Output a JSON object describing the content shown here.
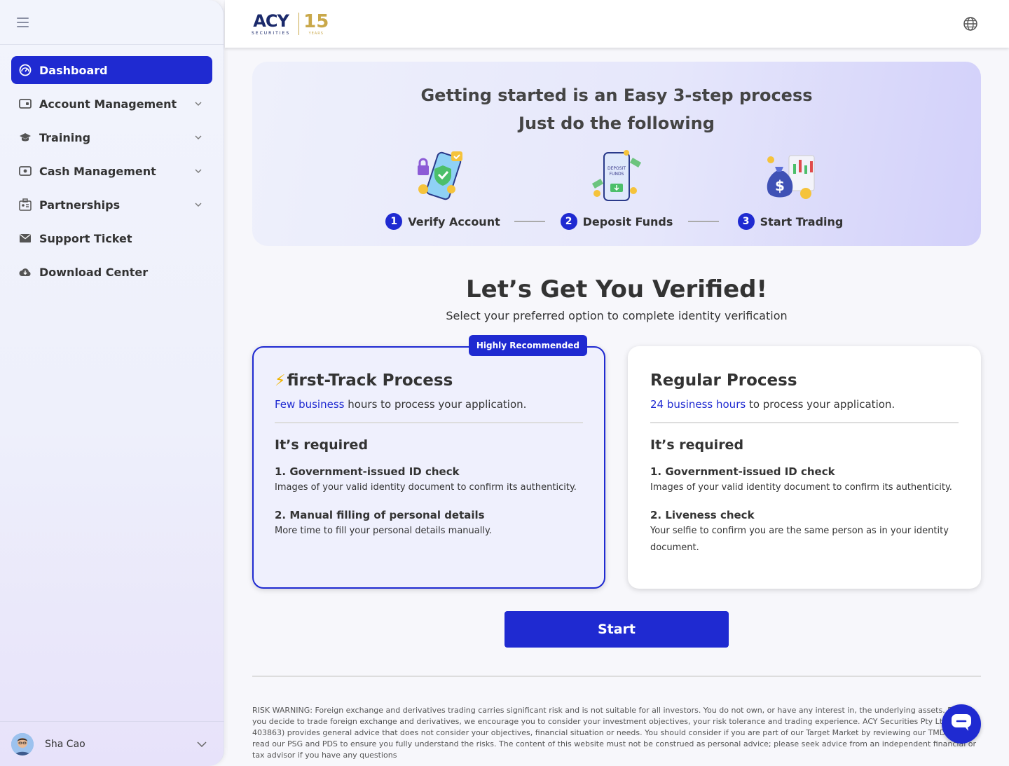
{
  "sidebar": {
    "items": [
      {
        "label": "Dashboard",
        "icon": "dashboard-icon",
        "active": true
      },
      {
        "label": "Account Management",
        "icon": "wallet-icon",
        "expandable": true
      },
      {
        "label": "Training",
        "icon": "graduation-cap-icon",
        "expandable": true
      },
      {
        "label": "Cash Management",
        "icon": "cash-icon",
        "expandable": true
      },
      {
        "label": "Partnerships",
        "icon": "partnerships-icon",
        "expandable": true
      },
      {
        "label": "Support Ticket",
        "icon": "envelope-icon"
      },
      {
        "label": "Download Center",
        "icon": "cloud-download-icon"
      }
    ],
    "user": {
      "name": "Sha Cao"
    }
  },
  "header": {
    "logo": {
      "brand": "ACY",
      "sub": "SECURITIES",
      "anniversary": "15",
      "anniversary_sub": "YEARS"
    }
  },
  "steps": {
    "title_line1": "Getting started is an Easy 3-step process",
    "title_line2": "Just do the following",
    "items": [
      {
        "num": "1",
        "label": "Verify Account"
      },
      {
        "num": "2",
        "label": "Deposit Funds"
      },
      {
        "num": "3",
        "label": "Start Trading"
      }
    ]
  },
  "verify": {
    "title": "Let’s Get You Verified!",
    "subtitle": "Select your preferred option to complete identity verification"
  },
  "cards": {
    "fast": {
      "badge": "Highly Recommended",
      "title": "first-Track Process",
      "time_hl": "Few business",
      "time_rest": " hours to process your application.",
      "req_title": "It’s required",
      "req1_h": "1. Government-issued ID check",
      "req1_d": "Images of your valid identity document to confirm its authenticity.",
      "req2_h": "2. Manual filling of personal details",
      "req2_d": "More time to fill your personal details manually."
    },
    "regular": {
      "title": "Regular Process",
      "time_hl": "24 business hours",
      "time_rest": " to process your application.",
      "req_title": "It’s required",
      "req1_h": "1. Government-issued ID check",
      "req1_d": "Images of your valid identity document to confirm its authenticity.",
      "req2_h": "2. Liveness check",
      "req2_d": "Your selfie to confirm you are the same person as in your identity document."
    }
  },
  "start_label": "Start",
  "risk_warning": "RISK WARNING: Foreign exchange and derivatives trading carries significant risk and is not suitable for all investors. You do not own, or have any interest in, the underlying assets. Before you decide to trade foreign exchange and derivatives, we encourage you to consider your investment objectives, your risk tolerance and trading experience. ACY Securities Pty Ltd (AFSL: 403863) provides general advice that does not consider your objectives, financial situation or needs. You should consider if you are part of our Target Market by reviewing our TMD and read our PSG and PDS to ensure you fully understand the risks. The content of this website must not be construed as personal advice; please seek advice from an independent financial or tax advisor if you have any questions",
  "colors": {
    "accent": "#1f2ad1",
    "gold": "#c9a84a",
    "bolt": "#f0b400"
  }
}
